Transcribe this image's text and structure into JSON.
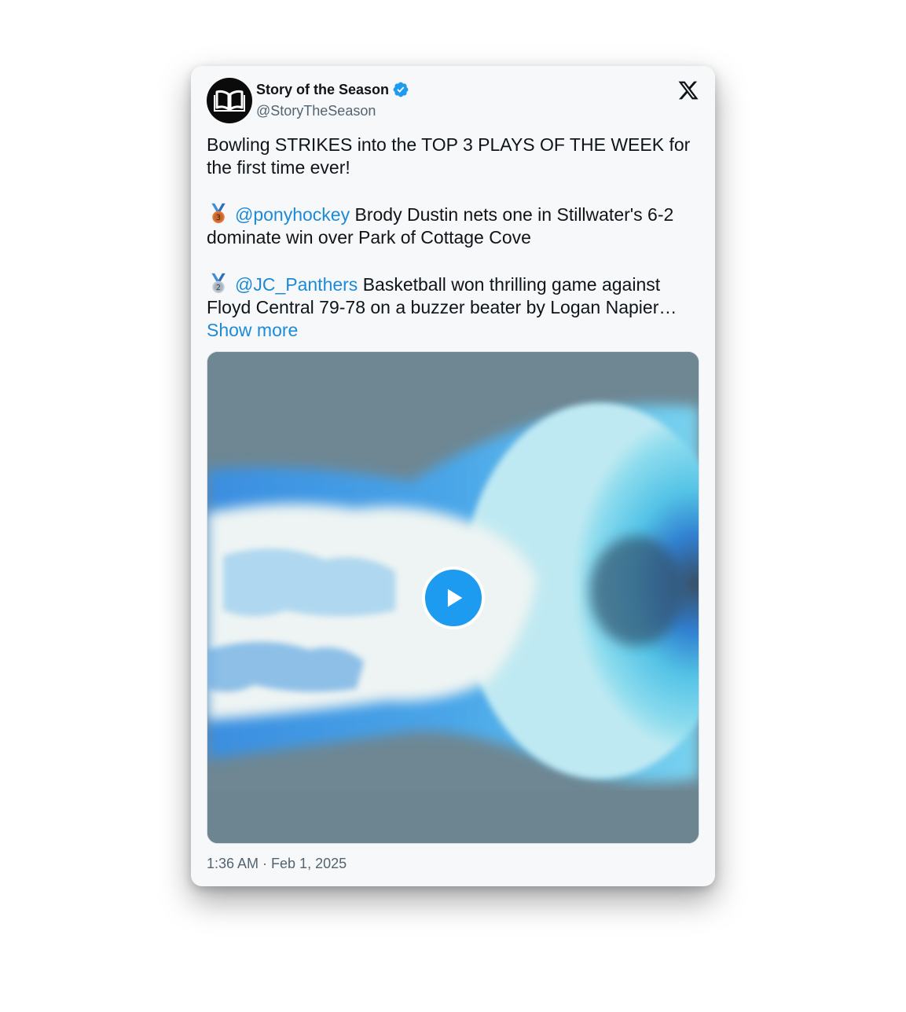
{
  "account": {
    "display_name": "Story of the Season",
    "handle": "@StoryTheSeason",
    "verified": true,
    "avatar_icon": "open-book-icon",
    "platform_logo": "x-logo-icon"
  },
  "tweet": {
    "intro": "Bowling STRIKES into the TOP 3 PLAYS OF THE WEEK for the first time ever!",
    "entries": [
      {
        "medal_icon": "third-place-medal-icon",
        "mention": "@ponyhockey",
        "text": " Brody Dustin nets one in Stillwater's 6-2 dominate win over Park of Cottage Cove"
      },
      {
        "medal_icon": "second-place-medal-icon",
        "mention": "@JC_Panthers",
        "text": " Basketball won thrilling game against Floyd Central 79-78 on a buzzer beater by Logan Napier… "
      }
    ],
    "show_more": "Show more",
    "timestamp": "1:36 AM · Feb 1, 2025"
  },
  "media": {
    "type": "video",
    "play_icon": "play-icon"
  },
  "colors": {
    "link": "#1d8ad8",
    "play_button": "#1d9bf0",
    "verified": "#1d9bf0",
    "text": "#0f1419",
    "muted": "#536471"
  }
}
